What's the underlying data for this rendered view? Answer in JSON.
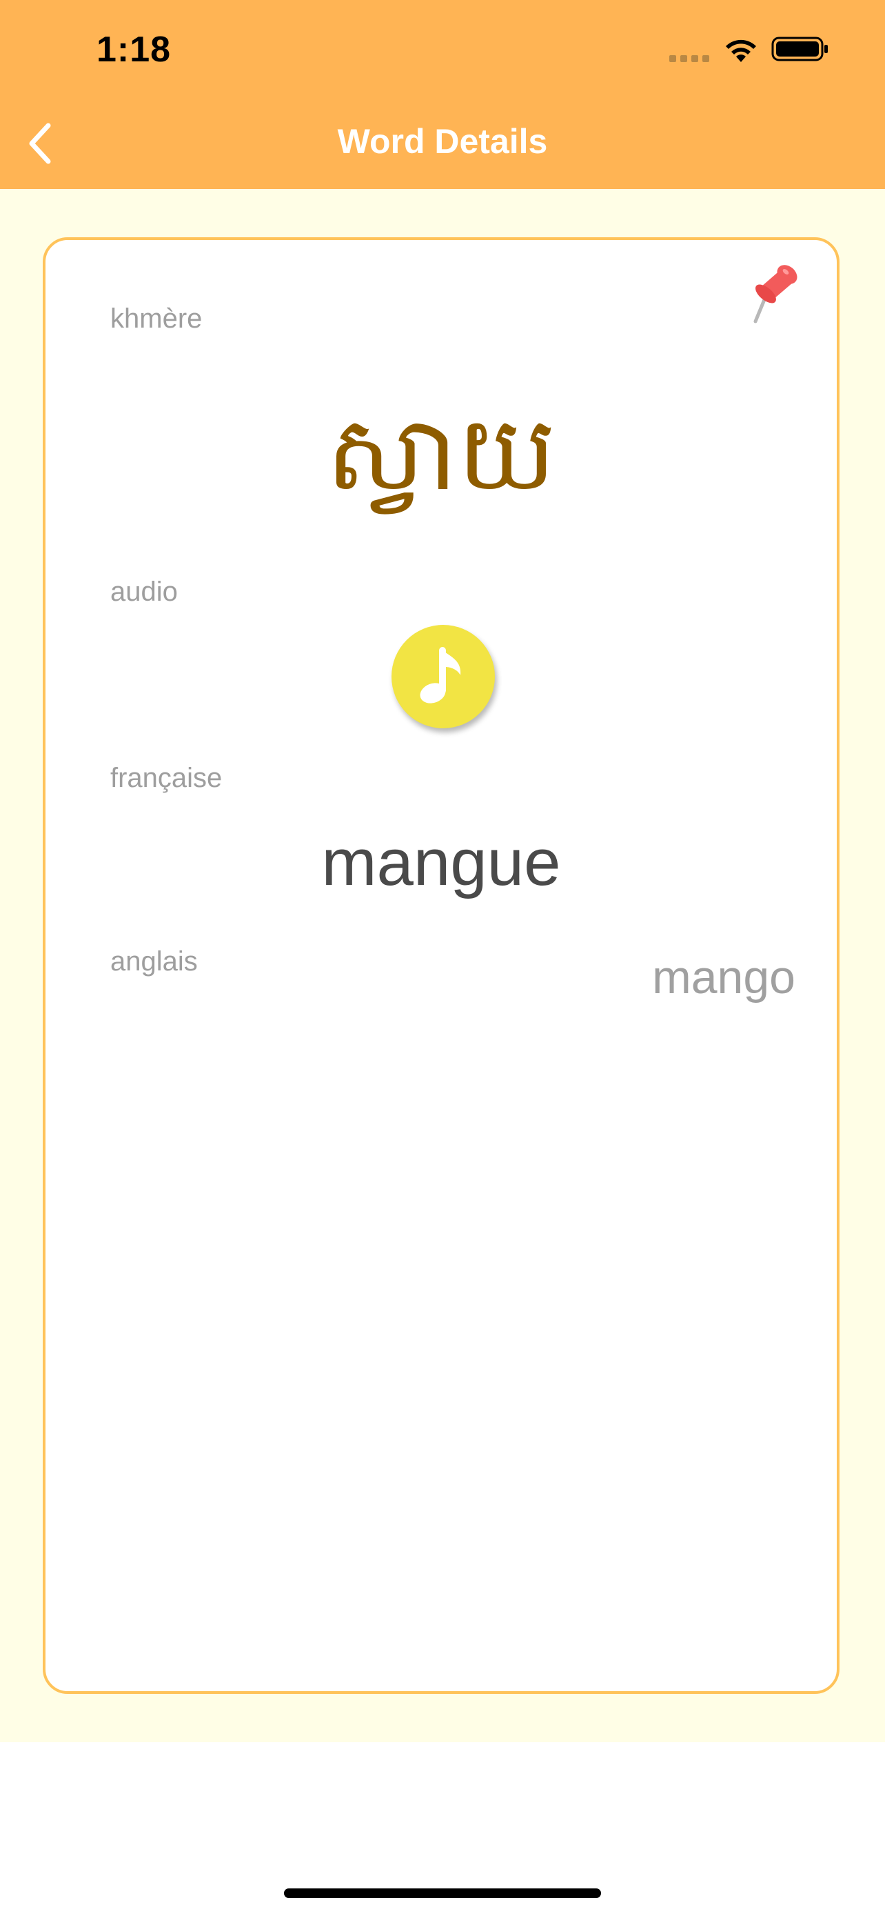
{
  "status_bar": {
    "time": "1:18"
  },
  "nav": {
    "title": "Word Details",
    "back_icon": "chevron-left-icon"
  },
  "card": {
    "pin_icon": "pushpin-icon",
    "khmer_label": "khmère",
    "khmer_word": "ស្វាយ",
    "audio_label": "audio",
    "audio_icon": "music-note-icon",
    "french_label": "française",
    "french_word": "mangue",
    "english_label": "anglais",
    "english_word": "mango"
  },
  "colors": {
    "header": "#FFB454",
    "content_bg": "#FFFEE6",
    "card_border": "#FFC35A",
    "khmer_text": "#8E5C00",
    "audio_button": "#F2E444",
    "pin": "#F25B5B"
  }
}
